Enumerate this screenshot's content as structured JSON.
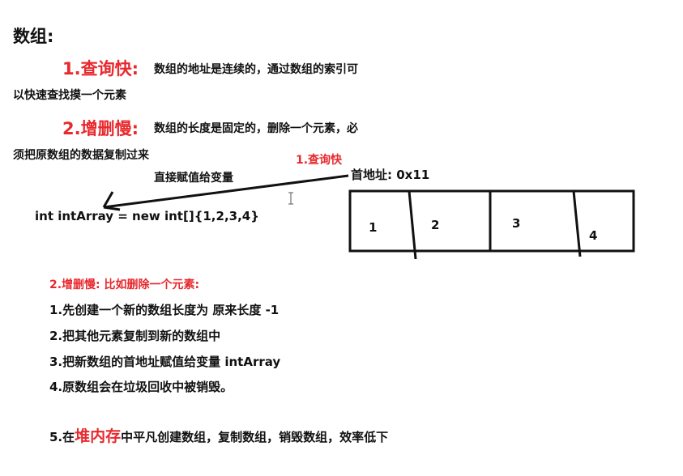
{
  "heading": "数组:",
  "point1": {
    "title": "1.查询快:",
    "desc_line1": "数组的地址是连续的，通过数组的索引可",
    "desc_line2": "以快速查找摸一个元素"
  },
  "point2": {
    "title": "2.增删慢:",
    "desc_line1": "数组的长度是固定的，删除一个元素，必",
    "desc_line2": "须把原数组的数据复制过来"
  },
  "diagram": {
    "query_label": "1.查询快",
    "assign_label": "直接赋值给变量",
    "address_label": "首地址: 0x11",
    "code": "int intArray = new int[]{1,2,3,4}",
    "cells": [
      "1",
      "2",
      "3",
      "4"
    ]
  },
  "delete_section": {
    "title": "2.增删慢: 比如删除一个元素:",
    "steps": [
      "1.先创建一个新的数组长度为 原来长度 -1",
      "2.把其他元素复制到新的数组中",
      "3.把新数组的首地址赋值给变量 intArray",
      "4.原数组会在垃圾回收中被销毁。"
    ]
  },
  "conclusion": {
    "prefix": "5.在",
    "highlight": "堆内存",
    "suffix": "中平凡创建数组，复制数组，销毁数组，效率低下"
  },
  "colors": {
    "accent_red": "#e8292e",
    "text": "#111111",
    "line": "#111111"
  }
}
